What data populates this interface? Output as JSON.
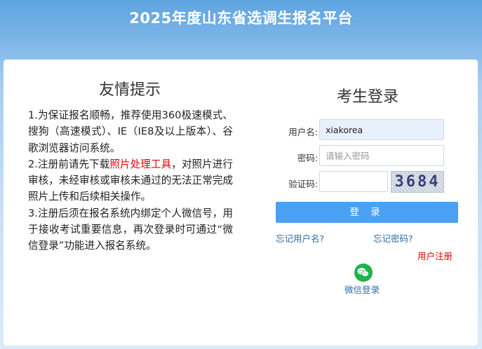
{
  "header": {
    "title": "2025年度山东省选调生报名平台"
  },
  "notice": {
    "title": "友情提示",
    "p1": "1.为保证报名顺畅，推荐使用360极速模式、搜狗（高速模式）、IE（IE8及以上版本）、谷歌浏览器访问系统。",
    "p2_before": "2.注册前请先下载",
    "p2_link": "照片处理工具",
    "p2_after": "，对照片进行审核，未经审核或审核未通过的无法正常完成照片上传和后续相关操作。",
    "p3": "3.注册后须在报名系统内绑定个人微信号，用于接收考试重要信息，再次登录时可通过“微信登录”功能进入报名系统。"
  },
  "login": {
    "title": "考生登录",
    "username_label": "用户名:",
    "username_value": "xiakorea",
    "password_label": "密码:",
    "password_placeholder": "请输入密码",
    "captcha_label": "验证码:",
    "captcha_value": "",
    "captcha_text": "3684",
    "submit_label": "登 录",
    "forgot_username": "忘记用户名?",
    "forgot_password": "忘记密码?",
    "register": "用户注册",
    "wechat_login": "微信登录"
  },
  "colors": {
    "accent": "#4aa1f3",
    "link": "#2e6da4",
    "danger": "#e60000",
    "wechat": "#22b24c"
  }
}
